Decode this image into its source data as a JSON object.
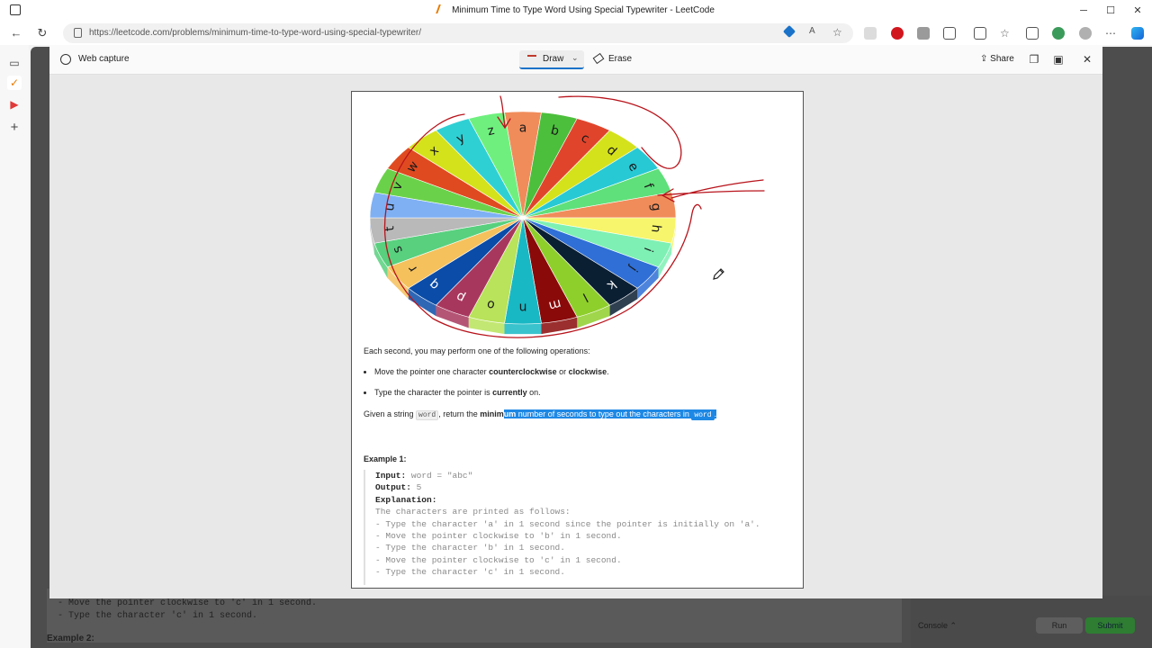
{
  "window": {
    "title": "Minimum Time to Type Word Using Special Typewriter - LeetCode",
    "minimize": "─",
    "maximize": "☐",
    "close": "✕"
  },
  "browser": {
    "url": "https://leetcode.com/problems/minimum-time-to-type-word-using-special-typewriter/"
  },
  "capture_toolbar": {
    "title": "Web capture",
    "draw_label": "Draw",
    "erase_label": "Erase",
    "share_label": "Share"
  },
  "wheel_letters": [
    "a",
    "b",
    "c",
    "d",
    "e",
    "f",
    "g",
    "h",
    "i",
    "j",
    "k",
    "l",
    "m",
    "n",
    "o",
    "p",
    "q",
    "r",
    "s",
    "t",
    "u",
    "v",
    "w",
    "x",
    "y",
    "z"
  ],
  "wheel_colors": [
    "#f08c5a",
    "#4cbf3c",
    "#e0452c",
    "#d4e21c",
    "#27c9d4",
    "#5fe07a",
    "#f08c5a",
    "#f7f56b",
    "#7ef0b4",
    "#2f6fd6",
    "#0b1f33",
    "#8fcf2b",
    "#8a0a0a",
    "#18b8c4",
    "#b8e35a",
    "#a8375e",
    "#0a4ca8",
    "#f5c15c",
    "#58d07e",
    "#b9b9b9",
    "#7fb0f4",
    "#6ad24a",
    "#e04a20",
    "#d4e21c",
    "#2fd0d4",
    "#6ff07e"
  ],
  "content": {
    "intro": "Each second, you may perform one of the following operations:",
    "bullet1": {
      "pre": "Move the pointer one character ",
      "b1": "counterclockwise",
      "mid": " or ",
      "b2": "clockwise",
      "post": "."
    },
    "bullet2": {
      "pre": "Type the character the pointer is ",
      "b1": "currently",
      "post": " on."
    },
    "given": {
      "pre": "Given a string ",
      "code1": "word",
      "mid": ", return the ",
      "b1a": "minim",
      "b1b": "um",
      "hl": " number of seconds to type out the characters in ",
      "code2": "word",
      "post": "."
    },
    "example_title": "Example 1:",
    "example_lines": {
      "input_k": "Input:",
      "input_v": " word = \"abc\"",
      "output_k": "Output:",
      "output_v": " 5",
      "expl_k": "Explanation:",
      "l1": "The characters are printed as follows:",
      "l2": "- Type the character 'a' in 1 second since the pointer is initially on 'a'.",
      "l3": "- Move the pointer clockwise to 'b' in 1 second.",
      "l4": "- Type the character 'b' in 1 second.",
      "l5": "- Move the pointer clockwise to 'c' in 1 second.",
      "l6": "- Type the character 'c' in 1 second."
    }
  },
  "background": {
    "bottom_line1": "- Move the pointer clockwise to 'c' in 1 second.",
    "bottom_line2": "- Type the character 'c' in 1 second.",
    "example2": "Example 2:",
    "console": "Console ⌃",
    "run": "Run",
    "submit": "Submit"
  }
}
